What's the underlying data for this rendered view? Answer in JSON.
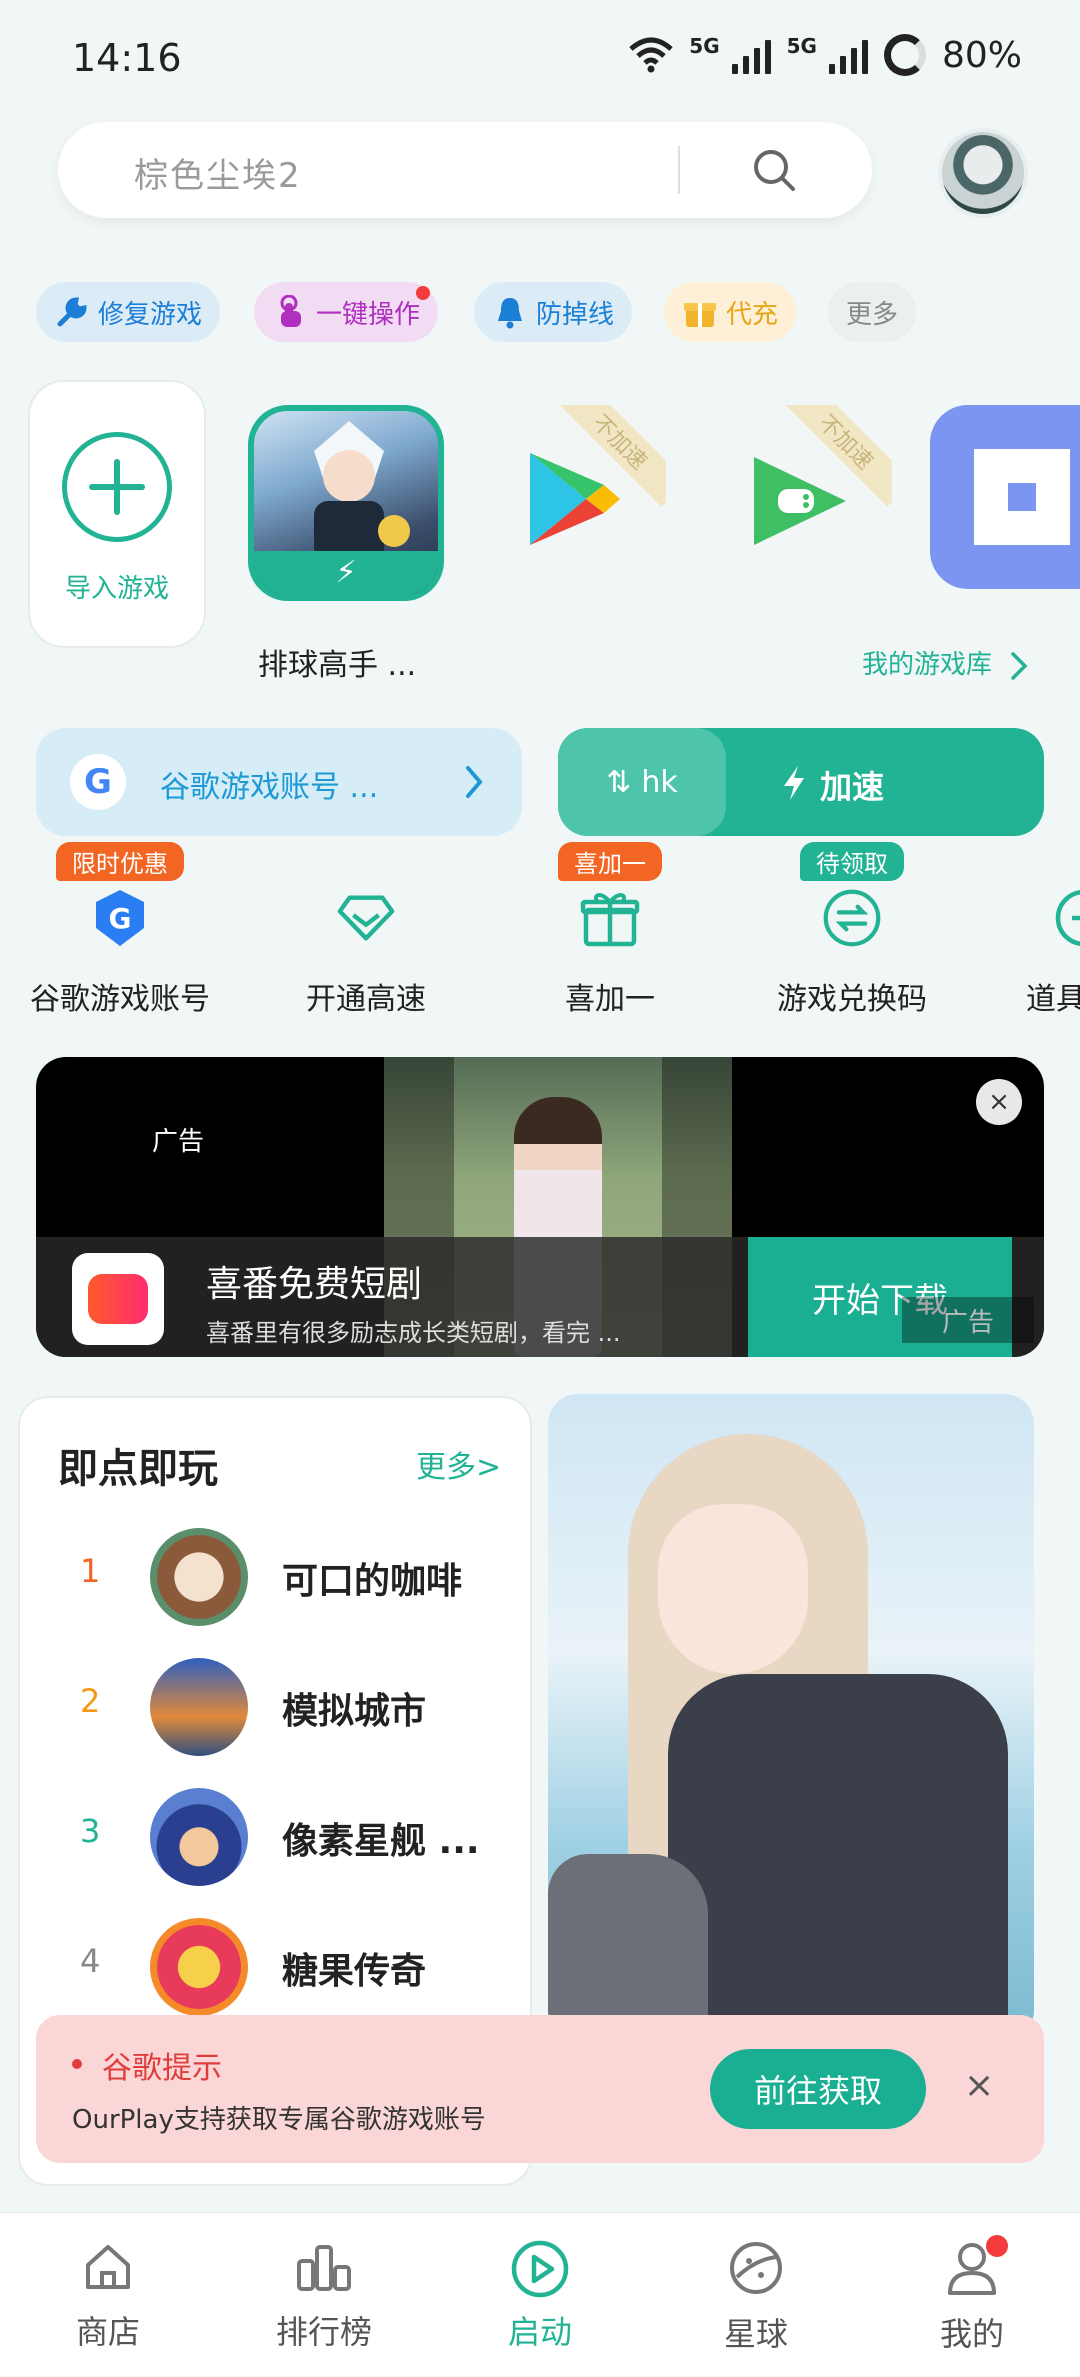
{
  "status_bar": {
    "time": "14:16",
    "network1": "5G",
    "network2": "5G",
    "battery": "80%"
  },
  "search": {
    "placeholder": "棕色尘埃2"
  },
  "chips": [
    {
      "label": "修复游戏",
      "bg": "#dcecf7",
      "color": "#1c7fd6"
    },
    {
      "label": "一键操作",
      "bg": "#f1dcf3",
      "color": "#b02fbf"
    },
    {
      "label": "防掉线",
      "bg": "#dcecf7",
      "color": "#1c7fd6"
    },
    {
      "label": "代充",
      "bg": "#fdf0d6",
      "color": "#e5a516"
    },
    {
      "label": "更多",
      "bg": "#ebefef",
      "color": "#888888"
    }
  ],
  "games": {
    "import_label": "导入游戏",
    "volley_label": "排球高手 ...",
    "no_speed_tag": "不加速",
    "library_link": "我的游戏库"
  },
  "google_account": {
    "label": "谷歌游戏账号 ..."
  },
  "accelerate": {
    "region": "hk",
    "label": "加速"
  },
  "quick_icons": [
    {
      "label": "谷歌游戏账号",
      "badge": "限时优惠",
      "badge_color": "#f26522"
    },
    {
      "label": "开通高速",
      "badge": "",
      "badge_color": ""
    },
    {
      "label": "喜加一",
      "badge": "喜加一",
      "badge_color": "#f26522"
    },
    {
      "label": "游戏兑换码",
      "badge": "待领取",
      "badge_color": "#22b394"
    },
    {
      "label": "道具",
      "badge": "",
      "badge_color": ""
    }
  ],
  "ad": {
    "tag": "广告",
    "title": "喜番免费短剧",
    "subtitle": "喜番里有很多励志成长类短剧，看完 ...",
    "cta": "开始下载",
    "watermark": "广告",
    "close": "×"
  },
  "instant_play": {
    "title": "即点即玩",
    "more": "更多>",
    "items": [
      {
        "rank": "1",
        "name": "可口的咖啡",
        "rank_color": "#f26522"
      },
      {
        "rank": "2",
        "name": "模拟城市",
        "rank_color": "#f59a16"
      },
      {
        "rank": "3",
        "name": "像素星舰 ...",
        "rank_color": "#22b394"
      },
      {
        "rank": "4",
        "name": "糖果传奇",
        "rank_color": "#888888"
      }
    ]
  },
  "toast": {
    "title": "谷歌提示",
    "desc": "OurPlay支持获取专属谷歌游戏账号",
    "button": "前往获取",
    "close": "×"
  },
  "nav": [
    {
      "label": "商店",
      "active": false
    },
    {
      "label": "排行榜",
      "active": false
    },
    {
      "label": "启动",
      "active": true
    },
    {
      "label": "星球",
      "active": false
    },
    {
      "label": "我的",
      "active": false
    }
  ],
  "colors": {
    "accent": "#22b394",
    "text": "#222222"
  }
}
